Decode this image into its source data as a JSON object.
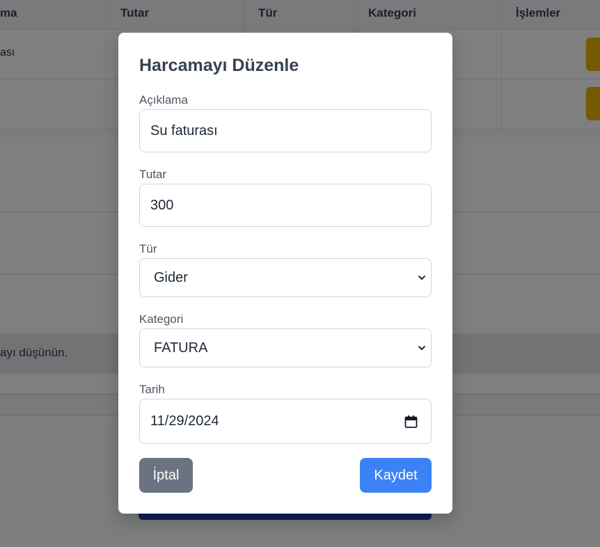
{
  "background": {
    "table_headers": [
      "ma",
      "Tutar",
      "Tür",
      "Kategori",
      "İşlemler"
    ],
    "row1_desc": "ası",
    "tip_text": "ayı düşünün."
  },
  "modal": {
    "title": "Harcamayı Düzenle",
    "description": {
      "label": "Açıklama",
      "value": "Su faturası"
    },
    "amount": {
      "label": "Tutar",
      "value": "300"
    },
    "type": {
      "label": "Tür",
      "value": "Gider"
    },
    "category": {
      "label": "Kategori",
      "value": "FATURA"
    },
    "date": {
      "label": "Tarih",
      "value": "11/29/2024"
    },
    "cancel_label": "İptal",
    "save_label": "Kaydet"
  },
  "colors": {
    "cancel_button": "#6b7280",
    "save_button": "#3b82f6",
    "edit_button": "#eab308",
    "overlay": "rgba(0,0,0,0.5)"
  },
  "icons": {
    "select_arrow": "chevron-down-icon",
    "date_picker": "calendar-icon"
  }
}
